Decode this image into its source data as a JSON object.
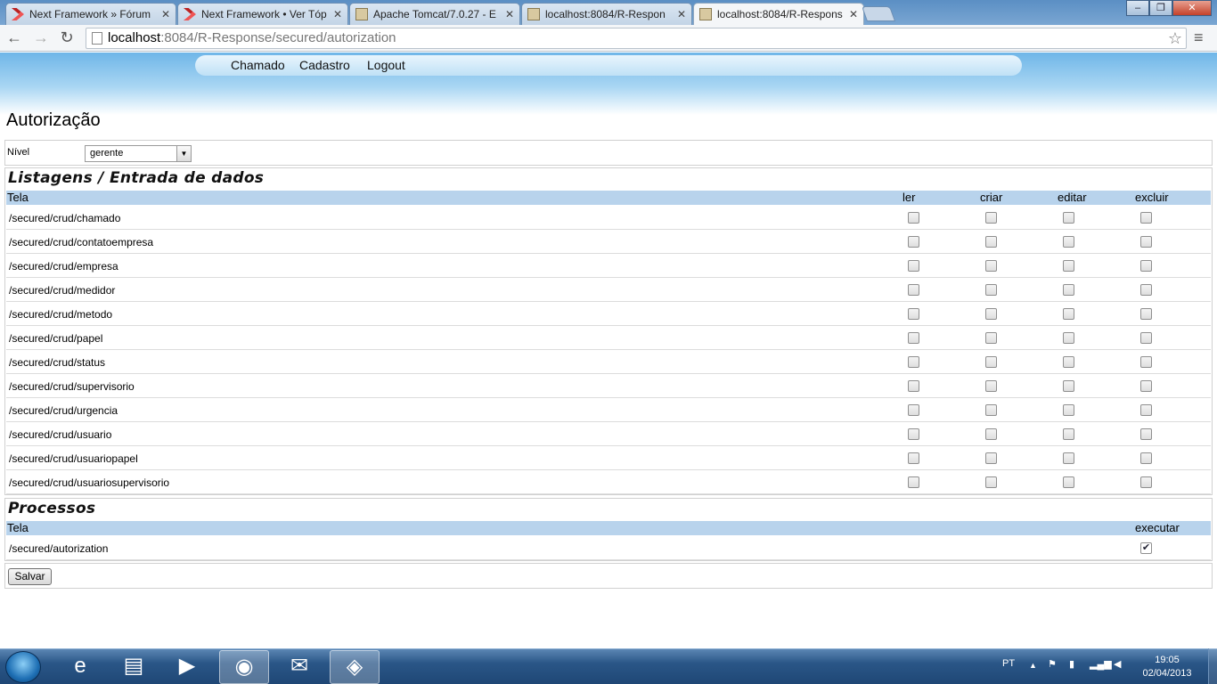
{
  "browser": {
    "tabs": [
      {
        "title": "Next Framework » Fórum",
        "icon": "next-framework-icon"
      },
      {
        "title": "Next Framework • Ver Tóp",
        "icon": "next-framework-icon"
      },
      {
        "title": "Apache Tomcat/7.0.27 - E",
        "icon": "tomcat-icon"
      },
      {
        "title": "localhost:8084/R-Respon",
        "icon": "tomcat-icon"
      },
      {
        "title": "localhost:8084/R-Respons",
        "icon": "tomcat-icon"
      }
    ],
    "close_glyph": "✕",
    "window": {
      "minimize": "‒",
      "maximize": "❐",
      "close": "✕"
    },
    "nav": {
      "back": "←",
      "forward": "→",
      "reload": "↻"
    },
    "url_host": "localhost",
    "url_rest": ":8084/R-Response/secured/autorization",
    "star_glyph": "☆",
    "menu_glyph": "≡"
  },
  "menu": {
    "chamado": "Chamado",
    "cadastro": "Cadastro",
    "logout": "Logout"
  },
  "page_title": "Autorização",
  "nivel": {
    "label": "Nível",
    "selected": "gerente",
    "arrow": "▼"
  },
  "listagens": {
    "title": "Listagens / Entrada de dados",
    "headers": {
      "tela": "Tela",
      "ler": "ler",
      "criar": "criar",
      "editar": "editar",
      "excluir": "excluir"
    },
    "rows": [
      {
        "path": "/secured/crud/chamado",
        "ler": false,
        "criar": false,
        "editar": false,
        "excluir": false
      },
      {
        "path": "/secured/crud/contatoempresa",
        "ler": false,
        "criar": false,
        "editar": false,
        "excluir": false
      },
      {
        "path": "/secured/crud/empresa",
        "ler": false,
        "criar": false,
        "editar": false,
        "excluir": false
      },
      {
        "path": "/secured/crud/medidor",
        "ler": false,
        "criar": false,
        "editar": false,
        "excluir": false
      },
      {
        "path": "/secured/crud/metodo",
        "ler": false,
        "criar": false,
        "editar": false,
        "excluir": false
      },
      {
        "path": "/secured/crud/papel",
        "ler": false,
        "criar": false,
        "editar": false,
        "excluir": false
      },
      {
        "path": "/secured/crud/status",
        "ler": false,
        "criar": false,
        "editar": false,
        "excluir": false
      },
      {
        "path": "/secured/crud/supervisorio",
        "ler": false,
        "criar": false,
        "editar": false,
        "excluir": false
      },
      {
        "path": "/secured/crud/urgencia",
        "ler": false,
        "criar": false,
        "editar": false,
        "excluir": false
      },
      {
        "path": "/secured/crud/usuario",
        "ler": false,
        "criar": false,
        "editar": false,
        "excluir": false
      },
      {
        "path": "/secured/crud/usuariopapel",
        "ler": false,
        "criar": false,
        "editar": false,
        "excluir": false
      },
      {
        "path": "/secured/crud/usuariosupervisorio",
        "ler": false,
        "criar": false,
        "editar": false,
        "excluir": false
      }
    ]
  },
  "processos": {
    "title": "Processos",
    "headers": {
      "tela": "Tela",
      "executar": "executar"
    },
    "rows": [
      {
        "path": "/secured/autorization",
        "executar": true
      }
    ]
  },
  "save_label": "Salvar",
  "check_glyph": "✔",
  "taskbar": {
    "apps": [
      {
        "name": "internet-explorer-icon",
        "glyph": "e"
      },
      {
        "name": "file-explorer-icon",
        "glyph": "▤"
      },
      {
        "name": "media-player-icon",
        "glyph": "▶"
      },
      {
        "name": "chrome-icon",
        "glyph": "◉"
      },
      {
        "name": "outlook-icon",
        "glyph": "✉"
      },
      {
        "name": "virtualbox-icon",
        "glyph": "◈"
      }
    ],
    "language": "PT",
    "tray_up": "▲",
    "time": "19:05",
    "date": "02/04/2013"
  }
}
